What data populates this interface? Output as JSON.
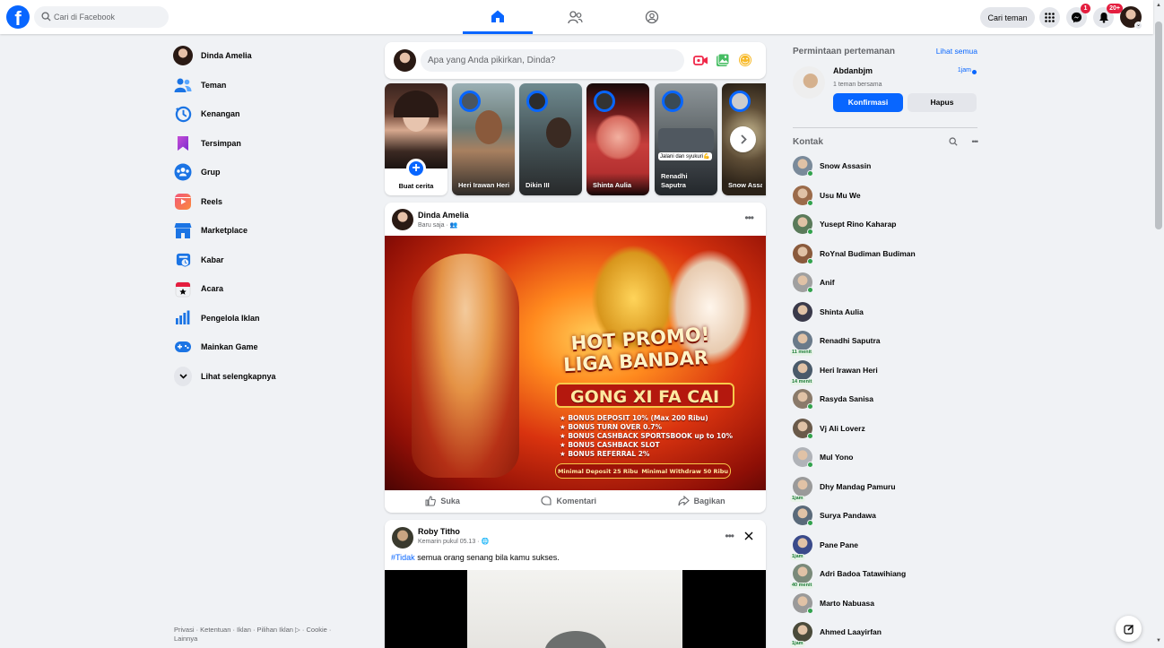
{
  "search": {
    "placeholder": "Cari di Facebook"
  },
  "header": {
    "find_friends": "Cari teman",
    "messenger_badge": "1",
    "notifications_badge": "20+"
  },
  "leftnav": {
    "profile_name": "Dinda Amelia",
    "items": [
      {
        "label": "Teman",
        "icon": "friends-icon"
      },
      {
        "label": "Kenangan",
        "icon": "memories-icon"
      },
      {
        "label": "Tersimpan",
        "icon": "saved-icon"
      },
      {
        "label": "Grup",
        "icon": "groups-icon"
      },
      {
        "label": "Reels",
        "icon": "reels-icon"
      },
      {
        "label": "Marketplace",
        "icon": "marketplace-icon"
      },
      {
        "label": "Kabar",
        "icon": "feeds-icon"
      },
      {
        "label": "Acara",
        "icon": "events-icon"
      },
      {
        "label": "Pengelola Iklan",
        "icon": "ads-manager-icon"
      },
      {
        "label": "Mainkan Game",
        "icon": "gaming-icon"
      }
    ],
    "see_more": "Lihat selengkapnya",
    "footer": "Privasi · Ketentuan · Iklan · Pilihan Iklan ▷ · Cookie · Lainnya"
  },
  "composer": {
    "placeholder": "Apa yang Anda pikirkan, Dinda?"
  },
  "stories": {
    "create_label": "Buat cerita",
    "items": [
      {
        "name": "Heri Irawan Heri",
        "caption": ""
      },
      {
        "name": "Dikin III",
        "caption": ""
      },
      {
        "name": "Shinta Aulia",
        "caption": ""
      },
      {
        "name": "Renadhi Saputra",
        "caption": "Jalani dan syukuri💪"
      },
      {
        "name": "Snow Assas",
        "caption": ""
      }
    ]
  },
  "post1": {
    "author": "Dinda Amelia",
    "meta": "Baru saja ·",
    "promo": {
      "line1": "HOT PROMO!",
      "line2": "LIGA BANDAR",
      "line3": "GONG XI FA CAI",
      "bullets": [
        "★ BONUS DEPOSIT 10% (Max 200 Ribu)",
        "★ BONUS TURN OVER 0.7%",
        "★ BONUS CASHBACK SPORTSBOOK up to 10%",
        "★ BONUS CASHBACK SLOT",
        "★ BONUS REFERRAL 2%"
      ],
      "min_deposit": "Minimal Deposit 25 Ribu",
      "min_withdraw": "Minimal Withdraw 50 Ribu"
    },
    "actions": {
      "like": "Suka",
      "comment": "Komentari",
      "share": "Bagikan"
    }
  },
  "post2": {
    "author": "Roby Titho",
    "meta": "Kemarin pukul 05.13 ·",
    "hashtag": "#Tidak",
    "text": " semua orang senang bila kamu sukses."
  },
  "friend_requests": {
    "title": "Permintaan pertemanan",
    "see_all": "Lihat semua",
    "name": "Abdanbjm",
    "mutual": "1 teman bersama",
    "time": "1jam",
    "confirm": "Konfirmasi",
    "delete": "Hapus"
  },
  "contacts": {
    "title": "Kontak",
    "items": [
      {
        "name": "Snow Assasin",
        "status": "online",
        "idle": ""
      },
      {
        "name": "Usu Mu We",
        "status": "online",
        "idle": ""
      },
      {
        "name": "Yusept Rino Kaharap",
        "status": "online",
        "idle": ""
      },
      {
        "name": "RoYnal Budiman Budiman",
        "status": "online",
        "idle": ""
      },
      {
        "name": "Anif",
        "status": "online",
        "idle": ""
      },
      {
        "name": "Shinta Aulia",
        "status": "none",
        "idle": ""
      },
      {
        "name": "Renadhi Saputra",
        "status": "idle",
        "idle": "11 menit"
      },
      {
        "name": "Heri Irawan Heri",
        "status": "idle",
        "idle": "14 menit"
      },
      {
        "name": "Rasyda Sanisa",
        "status": "online",
        "idle": ""
      },
      {
        "name": "Vj Ali Loverz",
        "status": "online",
        "idle": ""
      },
      {
        "name": "Mul Yono",
        "status": "online",
        "idle": ""
      },
      {
        "name": "Dhy Mandag Pamuru",
        "status": "idle",
        "idle": "1jam"
      },
      {
        "name": "Surya Pandawa",
        "status": "online",
        "idle": ""
      },
      {
        "name": "Pane Pane",
        "status": "idle",
        "idle": "1jam"
      },
      {
        "name": "Adri Badoa Tatawihiang",
        "status": "idle",
        "idle": "40 menit"
      },
      {
        "name": "Marto Nabuasa",
        "status": "online",
        "idle": ""
      },
      {
        "name": "Ahmed Laayirfan",
        "status": "idle",
        "idle": "1jam"
      }
    ]
  },
  "colors": {
    "accent": "#0866ff",
    "badge": "#e41e3f",
    "online": "#31a24c"
  }
}
